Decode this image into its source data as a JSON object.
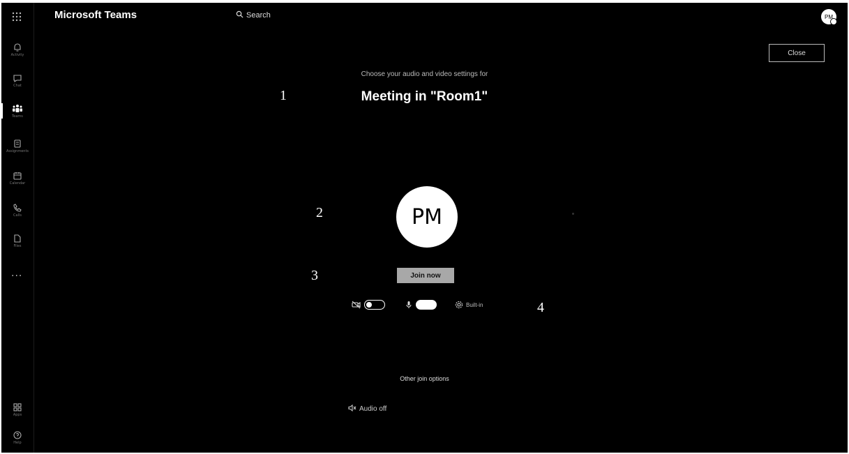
{
  "app": {
    "title": "Microsoft Teams"
  },
  "header": {
    "search_label": "Search",
    "avatar_initials": "PM"
  },
  "rail": {
    "items": [
      {
        "name": "activity",
        "label": "Activity",
        "icon": "bell-icon"
      },
      {
        "name": "chat",
        "label": "Chat",
        "icon": "chat-icon"
      },
      {
        "name": "teams",
        "label": "Teams",
        "icon": "teams-icon",
        "active": true
      },
      {
        "name": "assignments",
        "label": "Assignments",
        "icon": "assignments-icon"
      },
      {
        "name": "calendar",
        "label": "Calendar",
        "icon": "calendar-icon"
      },
      {
        "name": "calls",
        "label": "Calls",
        "icon": "phone-icon"
      },
      {
        "name": "files",
        "label": "Files",
        "icon": "file-icon"
      }
    ],
    "more_label": "...",
    "bottom": [
      {
        "name": "apps",
        "label": "Apps",
        "icon": "apps-icon"
      },
      {
        "name": "help",
        "label": "Help",
        "icon": "help-icon"
      }
    ]
  },
  "prejoin": {
    "close_label": "Close",
    "subtitle": "Choose your audio and video settings for",
    "meeting_title": "Meeting in \"Room1\"",
    "avatar_initials": "PM",
    "join_label": "Join now",
    "camera_state": "off",
    "mic_state": "on",
    "devices_label": "Built-in",
    "other_options_label": "Other join options",
    "audio_off_label": "Audio off"
  },
  "callouts": {
    "c1": "1",
    "c2": "2",
    "c3": "3",
    "c4": "4"
  },
  "colors": {
    "background": "#000000",
    "foreground": "#ffffff",
    "join_button": "#a8a8a8"
  }
}
